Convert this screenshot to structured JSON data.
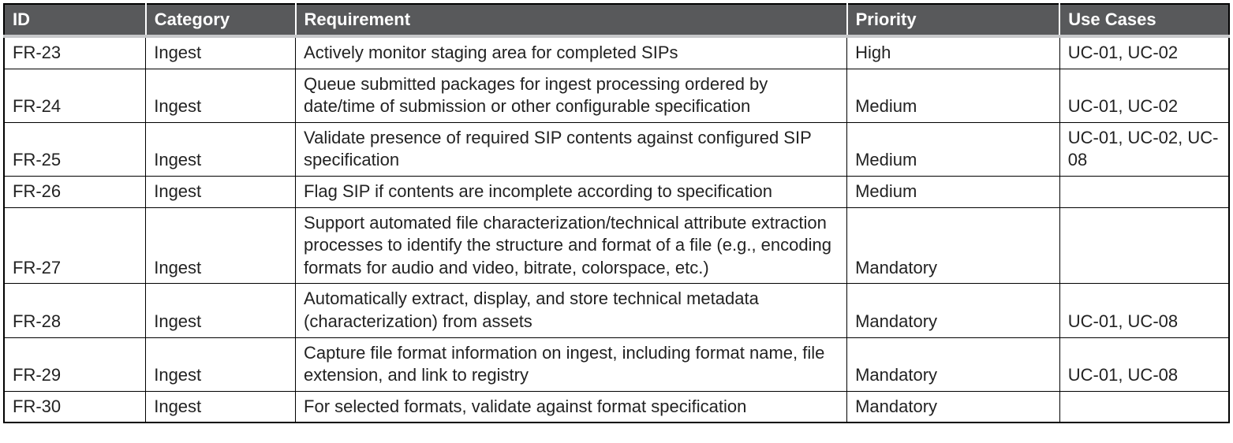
{
  "table": {
    "headers": {
      "id": "ID",
      "category": "Category",
      "requirement": "Requirement",
      "priority": "Priority",
      "use_cases": "Use Cases"
    },
    "rows": [
      {
        "id": "FR-23",
        "category": "Ingest",
        "requirement": "Actively monitor staging area for completed SIPs",
        "priority": "High",
        "use_cases": "UC-01, UC-02"
      },
      {
        "id": "FR-24",
        "category": "Ingest",
        "requirement": "Queue submitted packages for ingest processing ordered by date/time of submission or other configurable specification",
        "priority": "Medium",
        "use_cases": "UC-01, UC-02"
      },
      {
        "id": "FR-25",
        "category": "Ingest",
        "requirement": "Validate presence of required SIP contents against configured SIP specification",
        "priority": "Medium",
        "use_cases": "UC-01, UC-02, UC-08"
      },
      {
        "id": "FR-26",
        "category": "Ingest",
        "requirement": "Flag SIP if contents are incomplete according to specification",
        "priority": "Medium",
        "use_cases": ""
      },
      {
        "id": "FR-27",
        "category": "Ingest",
        "requirement": "Support automated file characterization/technical attribute extraction processes to identify the structure and format of a file (e.g., encoding formats for audio and video, bitrate, colorspace, etc.)",
        "priority": "Mandatory",
        "use_cases": ""
      },
      {
        "id": "FR-28",
        "category": "Ingest",
        "requirement": "Automatically extract, display, and store technical metadata (characterization) from assets",
        "priority": "Mandatory",
        "use_cases": "UC-01, UC-08"
      },
      {
        "id": "FR-29",
        "category": "Ingest",
        "requirement": "Capture file format information on ingest, including format name, file extension, and link to registry",
        "priority": "Mandatory",
        "use_cases": "UC-01, UC-08"
      },
      {
        "id": "FR-30",
        "category": "Ingest",
        "requirement": "For selected formats, validate against format specification",
        "priority": "Mandatory",
        "use_cases": ""
      }
    ]
  }
}
